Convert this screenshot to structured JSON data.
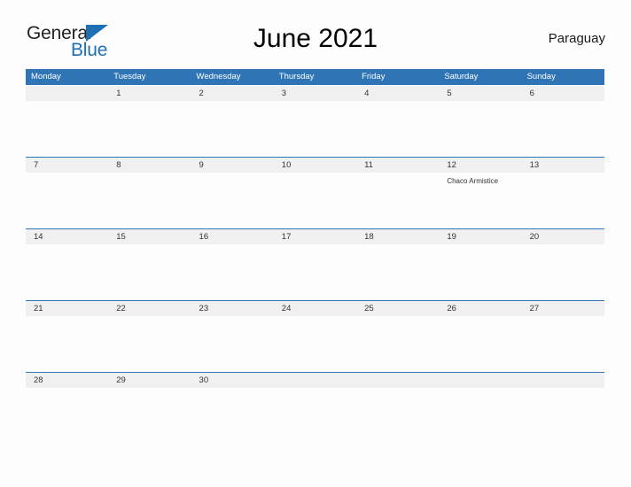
{
  "brand": {
    "name_part1": "General",
    "name_part2": "Blue",
    "triangle_icon": "triangle-icon",
    "accent_color": "#1f6fb5"
  },
  "header": {
    "title": "June 2021",
    "country": "Paraguay"
  },
  "calendar": {
    "header_bg": "#2f75b5",
    "band_bg": "#f0f0f0",
    "rule_color": "#2f75b5",
    "weekday_headers": [
      "Monday",
      "Tuesday",
      "Wednesday",
      "Thursday",
      "Friday",
      "Saturday",
      "Sunday"
    ],
    "weeks": [
      [
        {
          "day": "",
          "event": ""
        },
        {
          "day": "1",
          "event": ""
        },
        {
          "day": "2",
          "event": ""
        },
        {
          "day": "3",
          "event": ""
        },
        {
          "day": "4",
          "event": ""
        },
        {
          "day": "5",
          "event": ""
        },
        {
          "day": "6",
          "event": ""
        }
      ],
      [
        {
          "day": "7",
          "event": ""
        },
        {
          "day": "8",
          "event": ""
        },
        {
          "day": "9",
          "event": ""
        },
        {
          "day": "10",
          "event": ""
        },
        {
          "day": "11",
          "event": ""
        },
        {
          "day": "12",
          "event": "Chaco Armistice"
        },
        {
          "day": "13",
          "event": ""
        }
      ],
      [
        {
          "day": "14",
          "event": ""
        },
        {
          "day": "15",
          "event": ""
        },
        {
          "day": "16",
          "event": ""
        },
        {
          "day": "17",
          "event": ""
        },
        {
          "day": "18",
          "event": ""
        },
        {
          "day": "19",
          "event": ""
        },
        {
          "day": "20",
          "event": ""
        }
      ],
      [
        {
          "day": "21",
          "event": ""
        },
        {
          "day": "22",
          "event": ""
        },
        {
          "day": "23",
          "event": ""
        },
        {
          "day": "24",
          "event": ""
        },
        {
          "day": "25",
          "event": ""
        },
        {
          "day": "26",
          "event": ""
        },
        {
          "day": "27",
          "event": ""
        }
      ],
      [
        {
          "day": "28",
          "event": ""
        },
        {
          "day": "29",
          "event": ""
        },
        {
          "day": "30",
          "event": ""
        },
        {
          "day": "",
          "event": ""
        },
        {
          "day": "",
          "event": ""
        },
        {
          "day": "",
          "event": ""
        },
        {
          "day": "",
          "event": ""
        }
      ]
    ]
  }
}
